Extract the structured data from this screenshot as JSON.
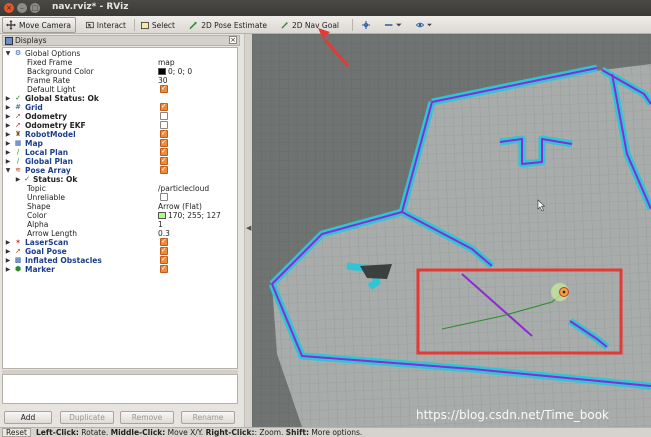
{
  "window": {
    "title": "nav.rviz* - RViz"
  },
  "toolbar": {
    "tools": [
      {
        "label": "Move Camera",
        "icon": "move-camera-icon"
      },
      {
        "label": "Interact",
        "icon": "interact-icon"
      },
      {
        "label": "Select",
        "icon": "select-icon"
      },
      {
        "label": "2D Pose Estimate",
        "icon": "pose-estimate-icon"
      },
      {
        "label": "2D Nav Goal",
        "icon": "nav-goal-icon"
      }
    ]
  },
  "displays": {
    "title": "Displays",
    "rows": [
      {
        "label": "Global Options"
      },
      {
        "label": "Fixed Frame",
        "value": "map"
      },
      {
        "label": "Background Color",
        "value": "0; 0; 0"
      },
      {
        "label": "Frame Rate",
        "value": "30"
      },
      {
        "label": "Default Light"
      },
      {
        "label": "Global Status: Ok"
      },
      {
        "label": "Grid"
      },
      {
        "label": "Odometry"
      },
      {
        "label": "Odometry EKF"
      },
      {
        "label": "RobotModel"
      },
      {
        "label": "Map"
      },
      {
        "label": "Local Plan"
      },
      {
        "label": "Global Plan"
      },
      {
        "label": "Pose Array"
      },
      {
        "label": "Status: Ok"
      },
      {
        "label": "Topic",
        "value": "/particlecloud"
      },
      {
        "label": "Unreliable"
      },
      {
        "label": "Shape",
        "value": "Arrow (Flat)"
      },
      {
        "label": "Color",
        "value": "170; 255; 127"
      },
      {
        "label": "Alpha",
        "value": "1"
      },
      {
        "label": "Arrow Length",
        "value": "0.3"
      },
      {
        "label": "LaserScan"
      },
      {
        "label": "Goal Pose"
      },
      {
        "label": "Inflated Obstacles"
      },
      {
        "label": "Marker"
      }
    ]
  },
  "buttons": {
    "add": "Add",
    "duplicate": "Duplicate",
    "remove": "Remove",
    "rename": "Rename"
  },
  "status": {
    "reset": "Reset",
    "k1": "Left-Click:",
    "v1": " Rotate. ",
    "k2": "Middle-Click:",
    "v2": " Move X/Y. ",
    "k3": "Right-Click:",
    "v3": ": Zoom. ",
    "k4": "Shift:",
    "v4": " More options."
  },
  "watermark": "https://blog.csdn.net/Time_book",
  "colors": {
    "accent_checkbox": "#f08a3b",
    "map_free": "#a8acab",
    "map_unknown": "#6f7473",
    "inflation": "#2ec6d6",
    "obstacle": "#8a2bd6",
    "highlight_box": "#e53935",
    "plan_line": "#2b8c2b"
  }
}
